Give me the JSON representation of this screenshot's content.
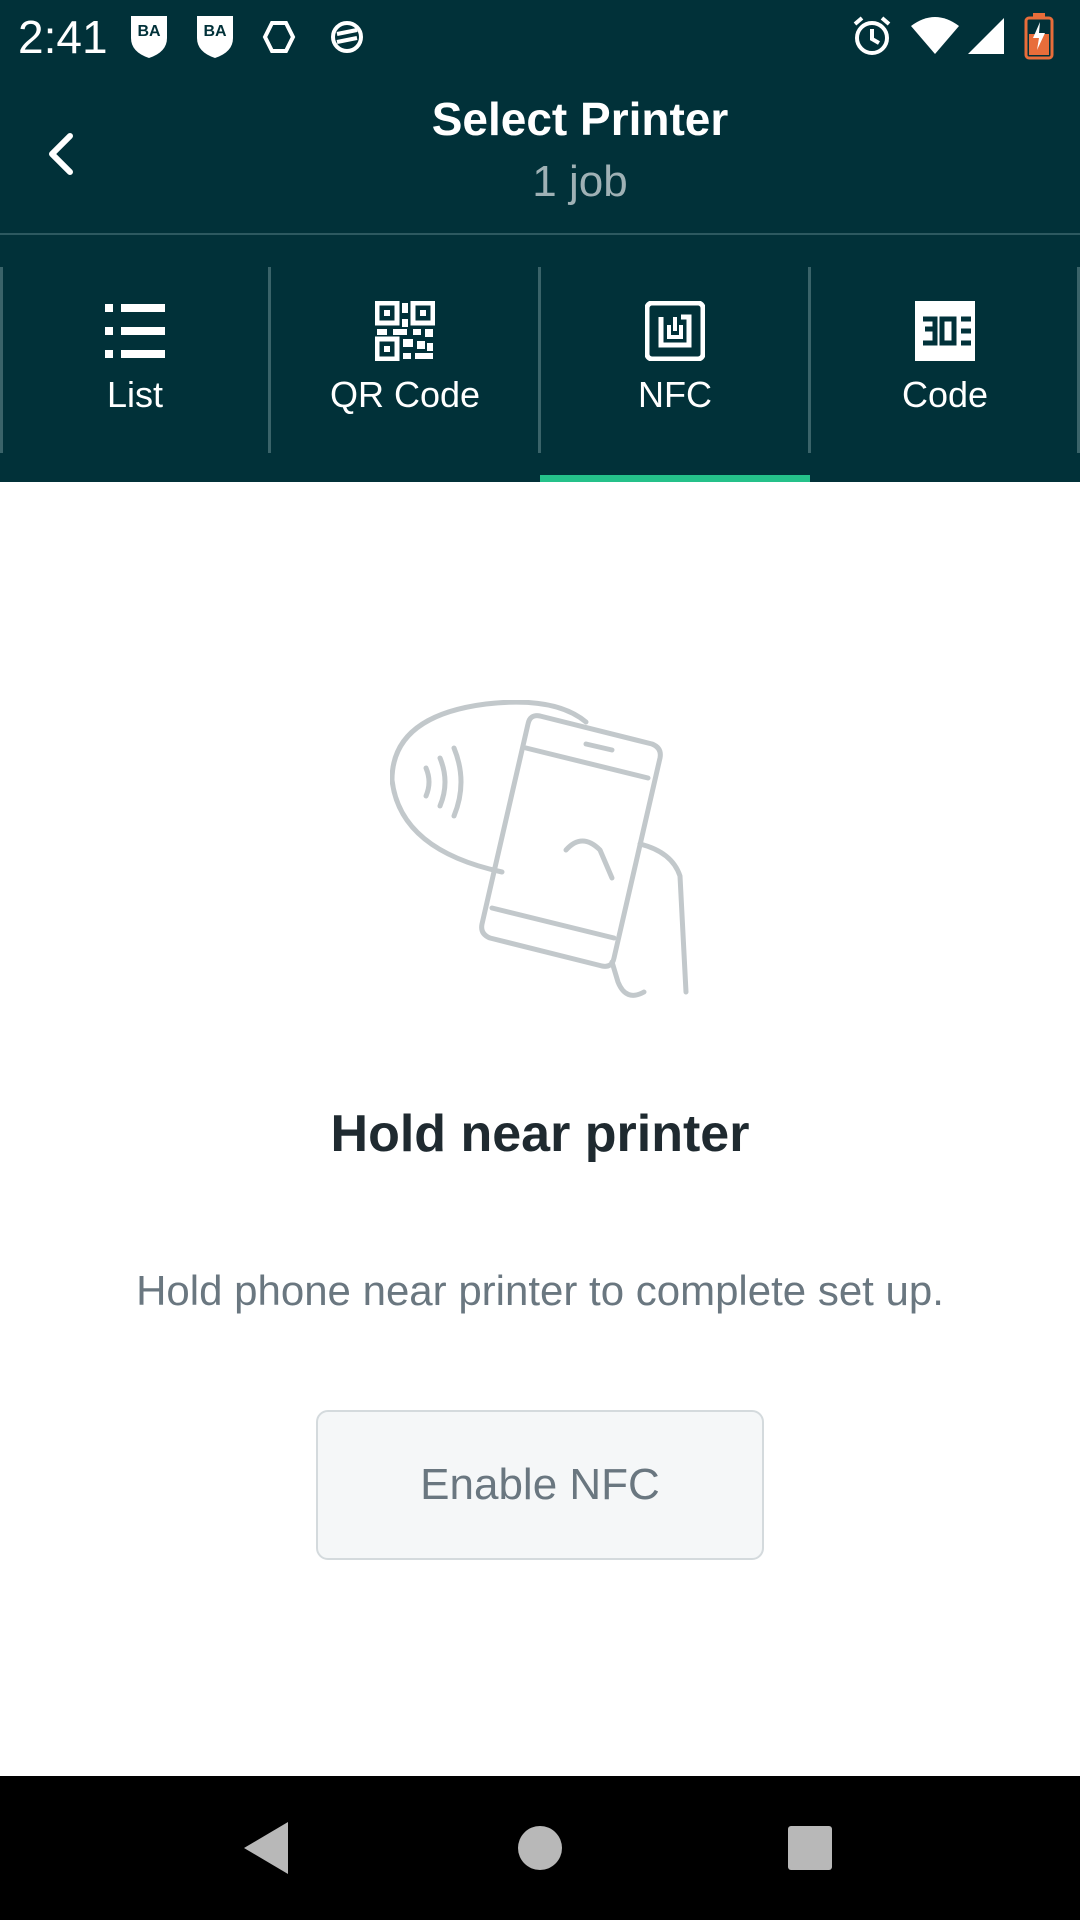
{
  "status_bar": {
    "time": "2:41",
    "icons": [
      "ba-shield-icon",
      "ba-shield-icon",
      "hexagon-icon",
      "sync-icon",
      "alarm-icon",
      "wifi-icon",
      "signal-icon",
      "battery-charging-icon"
    ],
    "ba_label": "BA"
  },
  "header": {
    "title": "Select Printer",
    "subtitle": "1 job",
    "back_icon": "chevron-left-icon"
  },
  "tabs": [
    {
      "label": "List",
      "icon": "list-icon",
      "active": false
    },
    {
      "label": "QR Code",
      "icon": "qr-code-icon",
      "active": false
    },
    {
      "label": "NFC",
      "icon": "nfc-icon",
      "active": true
    },
    {
      "label": "Code",
      "icon": "code-icon",
      "active": false
    }
  ],
  "content": {
    "illustration_icon": "phone-nfc-tap-icon",
    "heading": "Hold near printer",
    "description": "Hold phone near printer to complete set up.",
    "enable_button": "Enable NFC"
  },
  "nav_bar": {
    "icons": [
      "back-triangle-icon",
      "home-circle-icon",
      "recents-square-icon"
    ]
  },
  "colors": {
    "header_bg": "#013139",
    "accent": "#25c18a",
    "subtitle": "#9fb1b5",
    "heading_text": "#1f2a30",
    "body_text": "#6a7780"
  }
}
